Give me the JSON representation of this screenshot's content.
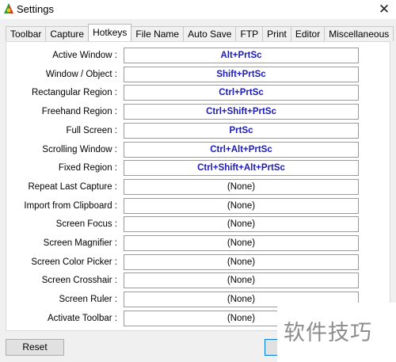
{
  "window": {
    "title": "Settings",
    "close_symbol": "✕"
  },
  "icons": {
    "app": "settings-app-icon",
    "close": "close-icon"
  },
  "tabs": [
    {
      "label": "Toolbar",
      "active": false
    },
    {
      "label": "Capture",
      "active": false
    },
    {
      "label": "Hotkeys",
      "active": true
    },
    {
      "label": "File Name",
      "active": false
    },
    {
      "label": "Auto Save",
      "active": false
    },
    {
      "label": "FTP",
      "active": false
    },
    {
      "label": "Print",
      "active": false
    },
    {
      "label": "Editor",
      "active": false
    },
    {
      "label": "Miscellaneous",
      "active": false
    }
  ],
  "hotkeys": [
    {
      "label": "Active Window :",
      "value": "Alt+PrtSc",
      "assigned": true
    },
    {
      "label": "Window / Object :",
      "value": "Shift+PrtSc",
      "assigned": true
    },
    {
      "label": "Rectangular Region :",
      "value": "Ctrl+PrtSc",
      "assigned": true
    },
    {
      "label": "Freehand Region :",
      "value": "Ctrl+Shift+PrtSc",
      "assigned": true
    },
    {
      "label": "Full Screen :",
      "value": "PrtSc",
      "assigned": true
    },
    {
      "label": "Scrolling Window :",
      "value": "Ctrl+Alt+PrtSc",
      "assigned": true
    },
    {
      "label": "Fixed Region :",
      "value": "Ctrl+Shift+Alt+PrtSc",
      "assigned": true
    },
    {
      "label": "Repeat Last Capture :",
      "value": "(None)",
      "assigned": false
    },
    {
      "label": "Import from Clipboard :",
      "value": "(None)",
      "assigned": false
    },
    {
      "label": "Screen Focus :",
      "value": "(None)",
      "assigned": false
    },
    {
      "label": "Screen Magnifier :",
      "value": "(None)",
      "assigned": false
    },
    {
      "label": "Screen Color Picker :",
      "value": "(None)",
      "assigned": false
    },
    {
      "label": "Screen Crosshair :",
      "value": "(None)",
      "assigned": false
    },
    {
      "label": "Screen Ruler :",
      "value": "(None)",
      "assigned": false
    },
    {
      "label": "Activate Toolbar :",
      "value": "(None)",
      "assigned": false
    }
  ],
  "buttons": {
    "reset": "Reset",
    "ok": ""
  },
  "watermark": "软件技巧",
  "colors": {
    "assigned_hotkey": "#1b1bb8",
    "unassigned_hotkey": "#000000",
    "focus_border": "#0078d7"
  }
}
